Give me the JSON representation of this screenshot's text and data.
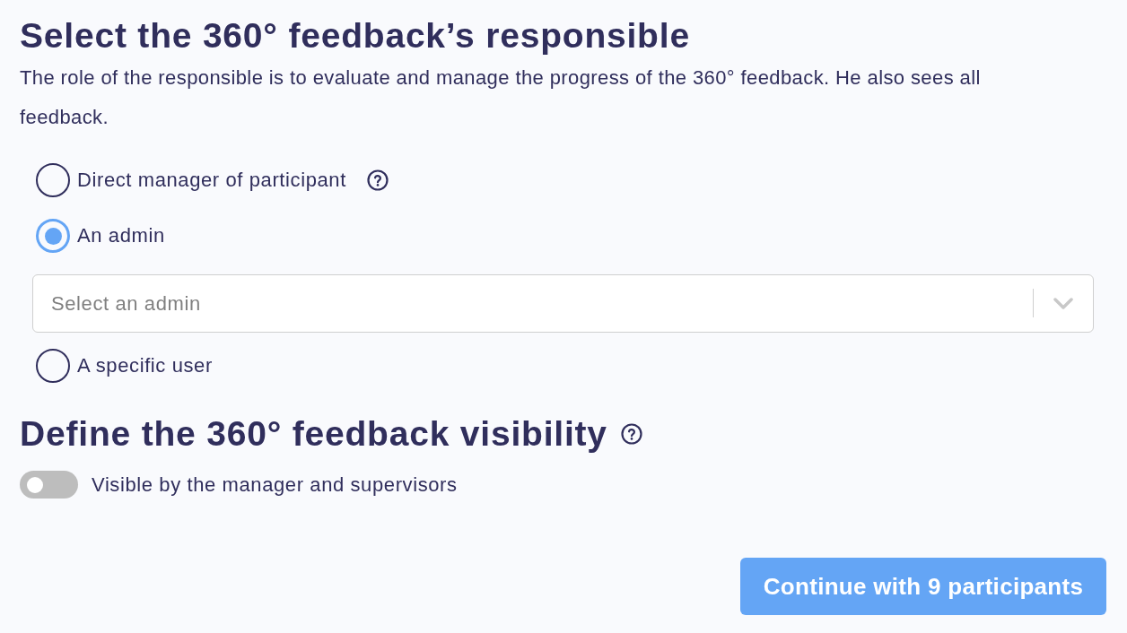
{
  "responsible": {
    "title": "Select the 360° feedback’s responsible",
    "description": "The role of the responsible is to evaluate and manage the progress of the 360° feedback. He also sees all feedback.",
    "options": [
      {
        "label": "Direct manager of participant",
        "selected": false,
        "help": true
      },
      {
        "label": "An admin",
        "selected": true,
        "help": false,
        "select": {
          "placeholder": "Select an admin"
        }
      },
      {
        "label": "A specific user",
        "selected": false,
        "help": false
      }
    ]
  },
  "visibility": {
    "title": "Define the 360° feedback visibility",
    "help": true,
    "toggle": {
      "label": "Visible by the manager and supervisors",
      "on": false
    }
  },
  "continue_button": {
    "label": "Continue with 9 participants"
  }
}
